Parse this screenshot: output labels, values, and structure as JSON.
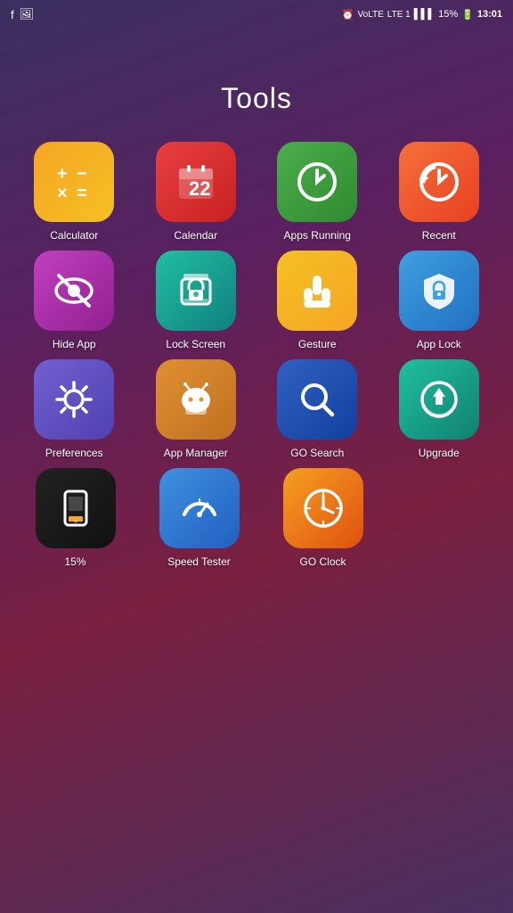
{
  "statusBar": {
    "time": "13:01",
    "battery": "15%",
    "notifications": [
      "fb",
      "photo"
    ]
  },
  "pageTitle": "Tools",
  "apps": [
    {
      "id": "calculator",
      "label": "Calculator",
      "iconClass": "icon-calculator"
    },
    {
      "id": "calendar",
      "label": "Calendar",
      "iconClass": "icon-calendar"
    },
    {
      "id": "apps-running",
      "label": "Apps Running",
      "iconClass": "icon-apps-running"
    },
    {
      "id": "recent",
      "label": "Recent",
      "iconClass": "icon-recent"
    },
    {
      "id": "hide-app",
      "label": "Hide App",
      "iconClass": "icon-hide-app"
    },
    {
      "id": "lock-screen",
      "label": "Lock Screen",
      "iconClass": "icon-lock-screen"
    },
    {
      "id": "gesture",
      "label": "Gesture",
      "iconClass": "icon-gesture"
    },
    {
      "id": "app-lock",
      "label": "App Lock",
      "iconClass": "icon-app-lock"
    },
    {
      "id": "preferences",
      "label": "Preferences",
      "iconClass": "icon-preferences"
    },
    {
      "id": "app-manager",
      "label": "App Manager",
      "iconClass": "icon-app-manager"
    },
    {
      "id": "go-search",
      "label": "GO Search",
      "iconClass": "icon-go-search"
    },
    {
      "id": "upgrade",
      "label": "Upgrade",
      "iconClass": "icon-upgrade"
    },
    {
      "id": "battery",
      "label": "15%",
      "iconClass": "icon-battery"
    },
    {
      "id": "speed-tester",
      "label": "Speed Tester",
      "iconClass": "icon-speed-tester"
    },
    {
      "id": "go-clock",
      "label": "GO Clock",
      "iconClass": "icon-go-clock"
    }
  ]
}
